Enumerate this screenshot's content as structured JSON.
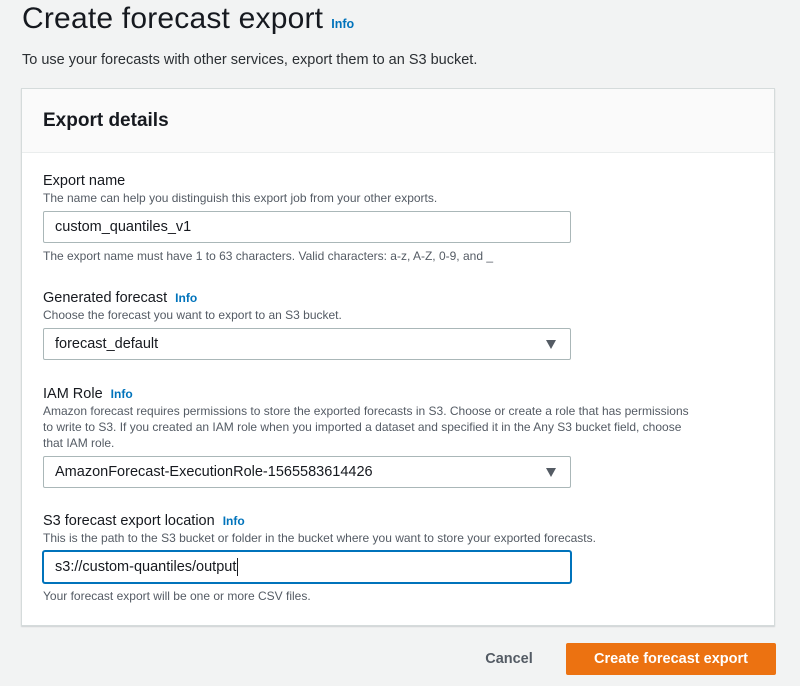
{
  "header": {
    "title": "Create forecast export",
    "info_label": "Info",
    "description": "To use your forecasts with other services, export them to an S3 bucket."
  },
  "panel": {
    "title": "Export details",
    "fields": {
      "export_name": {
        "label": "Export name",
        "description": "The name can help you distinguish this export job from your other exports.",
        "value": "custom_quantiles_v1",
        "constraint": "The export name must have 1 to 63 characters. Valid characters: a-z, A-Z, 0-9, and _"
      },
      "generated_forecast": {
        "label": "Generated forecast",
        "info_label": "Info",
        "description": "Choose the forecast you want to export to an S3 bucket.",
        "selected": "forecast_default"
      },
      "iam_role": {
        "label": "IAM Role",
        "info_label": "Info",
        "description_line1": "Amazon forecast requires permissions to store the exported forecasts in S3. Choose or create a role that has permissions",
        "description_line2": "to write to S3. If you created an IAM role when you imported a dataset and specified it in the Any S3 bucket field, choose",
        "description_line3": "that IAM role.",
        "selected": "AmazonForecast-ExecutionRole-1565583614426"
      },
      "s3_location": {
        "label": "S3 forecast export location",
        "info_label": "Info",
        "description": "This is the path to the S3 bucket or folder in the bucket where you want to store your exported forecasts.",
        "value": "s3://custom-quantiles/output",
        "constraint": "Your forecast export will be one or more CSV files."
      }
    }
  },
  "footer": {
    "cancel_label": "Cancel",
    "submit_label": "Create forecast export"
  },
  "colors": {
    "primary_button": "#ec7211",
    "link": "#0073bb",
    "focus": "#0073bb"
  }
}
